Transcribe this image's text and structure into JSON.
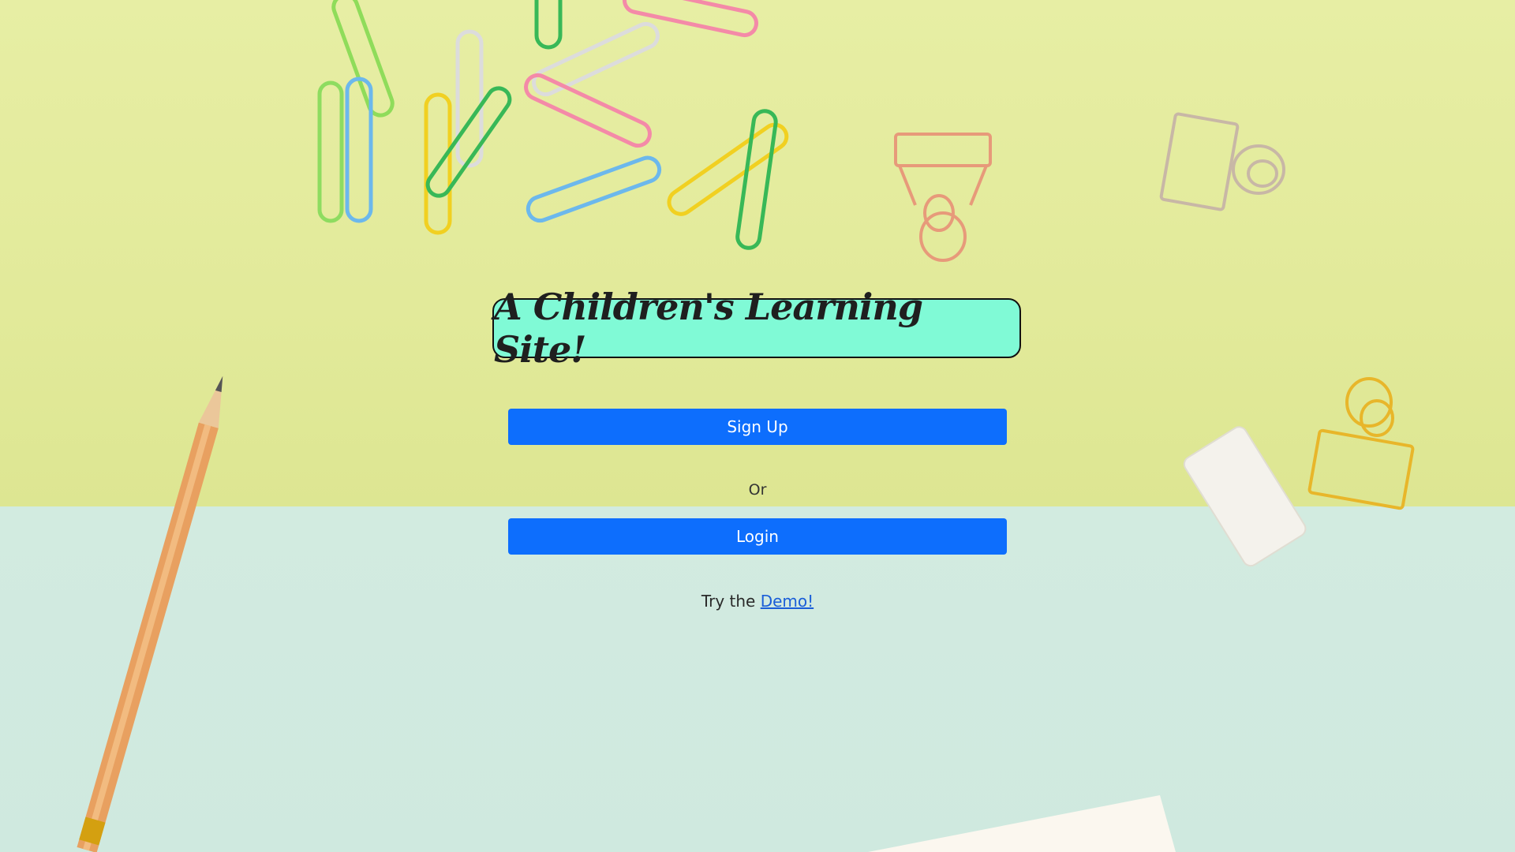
{
  "header": {
    "title": "A Children's Learning Site!"
  },
  "actions": {
    "signup_label": "Sign Up",
    "or_label": "Or",
    "login_label": "Login",
    "demo_prefix": "Try the ",
    "demo_link_label": "Demo!"
  },
  "colors": {
    "title_bg": "#80fad6",
    "button_bg": "#0d6efd",
    "bg_top": "#e2ea9a",
    "bg_bottom": "#d2ebe0",
    "link": "#1a5ed8"
  },
  "decor": {
    "items": [
      "paperclip-icon",
      "binder-clip-icon",
      "pencil-icon",
      "eraser-icon",
      "paper-sheet-icon"
    ]
  }
}
